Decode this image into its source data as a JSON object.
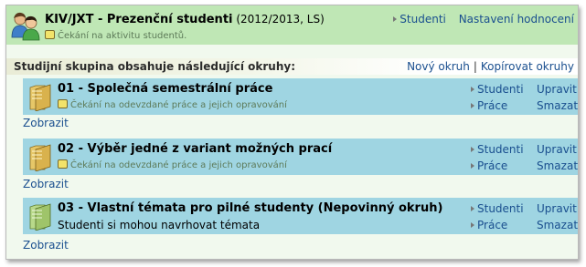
{
  "header": {
    "title": "KIV/JXT - Prezenční studenti",
    "subtitle": "(2012/2013, LS)",
    "status": "Čekání na aktivitu studentů.",
    "links": {
      "students": "Studenti",
      "settings": "Nastavení hodnocení"
    }
  },
  "group": {
    "title": "Studijní skupina obsahuje následující okruhy:",
    "new_topic": "Nový okruh",
    "separator": "|",
    "copy_topics": "Kopírovat okruhy"
  },
  "topics": [
    {
      "title": "01 - Společná semestrální práce",
      "status": "Čekání na odevzdané práce a jejich opravování",
      "students": "Studenti",
      "works": "Práce",
      "edit": "Upravit",
      "delete": "Smazat",
      "show": "Zobrazit"
    },
    {
      "title": "02 - Výběr jedné z variant možných prací",
      "status": "Čekání na odevzdané práce a jejich opravování",
      "students": "Studenti",
      "works": "Práce",
      "edit": "Upravit",
      "delete": "Smazat",
      "show": "Zobrazit"
    },
    {
      "title": "03 - Vlastní témata pro pilné studenty (Nepovinný okruh)",
      "description": "Studenti si mohou navrhovat témata",
      "students": "Studenti",
      "works": "Práce",
      "edit": "Upravit",
      "delete": "Smazat",
      "show": "Zobrazit"
    }
  ],
  "colors": {
    "header_bg": "#bfe7b5",
    "panel_bg": "#f1f9ee",
    "topic_bg": "#9fd5e2",
    "link": "#1a4f8f"
  }
}
